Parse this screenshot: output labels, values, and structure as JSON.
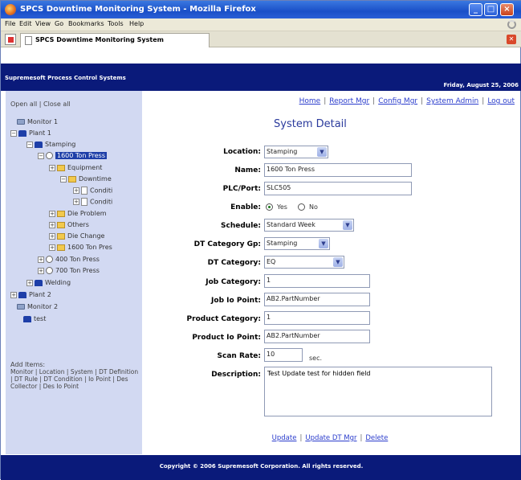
{
  "window": {
    "title": "SPCS Downtime Monitoring System - Mozilla Firefox"
  },
  "menubar": {
    "items": [
      "File",
      "Edit",
      "View",
      "Go",
      "Bookmarks",
      "Tools",
      "Help"
    ]
  },
  "tab": {
    "label": "SPCS Downtime Monitoring System"
  },
  "header": {
    "app_title": "Supremesoft Process Control Systems",
    "date": "Friday, August 25, 2006"
  },
  "leftnav": {
    "open_close": "Open all | Close all",
    "tree": [
      "Monitor 1",
      "Plant 1",
      "Stamping",
      "1600 Ton Press",
      "Equipment",
      "Downtime",
      "Conditi",
      "Conditi",
      "Die Problem",
      "Others",
      "Die Change",
      "1600 Ton Pres",
      "400 Ton Press",
      "700 Ton Press",
      "Welding",
      "Plant 2",
      "Monitor 2",
      "test"
    ],
    "add_items_title": "Add Items:",
    "add_items_links": "Monitor | Location | System | DT Definition | DT Rule | DT Condition | Io Point | Des Collector | Des Io Point"
  },
  "topnav": {
    "links": [
      "Home",
      "Report Mgr",
      "Config Mgr",
      "System Admin",
      "Log out"
    ]
  },
  "page_title": "System Detail",
  "form": {
    "location_label": "Location:",
    "location_value": "Stamping",
    "name_label": "Name:",
    "name_value": "1600 Ton Press",
    "plc_label": "PLC/Port:",
    "plc_value": "SLC505",
    "enable_label": "Enable:",
    "enable_yes": "Yes",
    "enable_no": "No",
    "schedule_label": "Schedule:",
    "schedule_value": "Standard Week",
    "dt_cat_gp_label": "DT Category Gp:",
    "dt_cat_gp_value": "Stamping",
    "dt_cat_label": "DT Category:",
    "dt_cat_value": "EQ",
    "job_cat_label": "Job Category:",
    "job_cat_value": "1",
    "job_io_label": "Job Io Point:",
    "job_io_value": "AB2.PartNumber",
    "prod_cat_label": "Product Category:",
    "prod_cat_value": "1",
    "prod_io_label": "Product Io Point:",
    "prod_io_value": "AB2.PartNumber",
    "scan_label": "Scan Rate:",
    "scan_value": "10",
    "scan_unit": "sec.",
    "desc_label": "Description:",
    "desc_value": "Test Update test for hidden field"
  },
  "actions": {
    "update": "Update",
    "update_dt_mgr": "Update DT Mgr",
    "delete": "Delete"
  },
  "footer": {
    "text": "Copyright © 2006 Supremesoft Corporation. All rights reserved."
  }
}
